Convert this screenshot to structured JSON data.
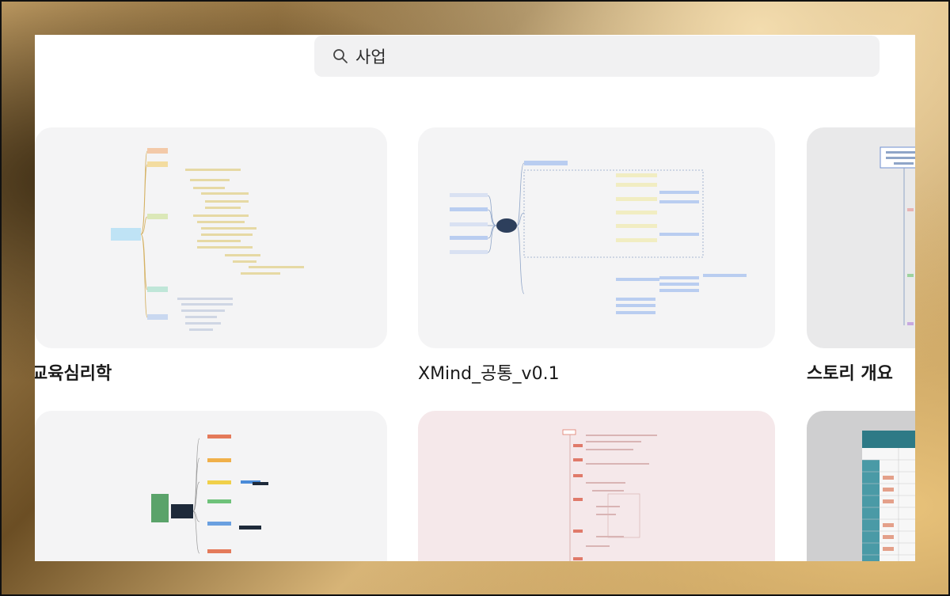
{
  "search": {
    "value": "사업",
    "icon": "search-icon"
  },
  "files": [
    {
      "title": "교육심리학",
      "thumb_bg": "#f4f4f5"
    },
    {
      "title": "XMind_공통_v0.1",
      "thumb_bg": "#f4f4f5"
    },
    {
      "title": "스토리 개요",
      "thumb_bg": "#e9e9ea"
    },
    {
      "title": "",
      "thumb_bg": "#f4f4f5"
    },
    {
      "title": "",
      "thumb_bg": "#f5e8ea"
    },
    {
      "title": "",
      "thumb_bg": "#cfcfd0"
    }
  ]
}
